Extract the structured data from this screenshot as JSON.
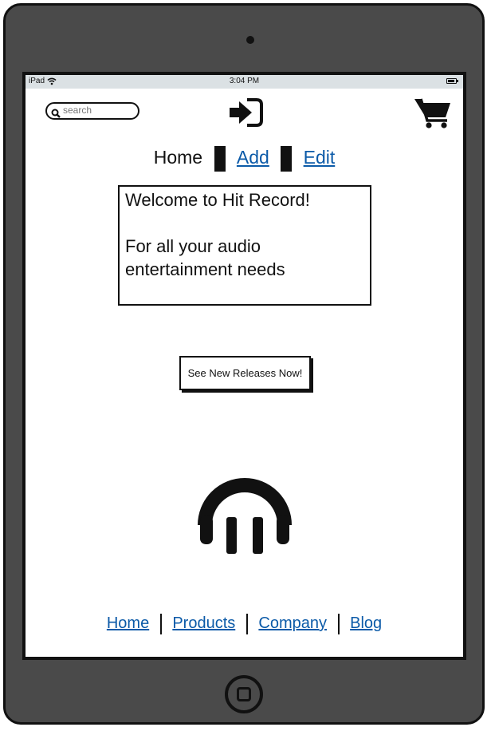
{
  "status_bar": {
    "carrier": "iPad",
    "time": "3:04 PM"
  },
  "header": {
    "search_placeholder": "search",
    "icons": [
      "search-icon",
      "login-icon",
      "cart-icon"
    ]
  },
  "top_nav": {
    "current": "Home",
    "links": [
      "Add",
      "Edit"
    ]
  },
  "welcome": {
    "line1": "Welcome to Hit Record!",
    "line2": "For all your audio",
    "line3": "entertainment needs"
  },
  "cta": {
    "label": "See New Releases Now!"
  },
  "hero_icon": "headphones-icon",
  "footer_nav": {
    "links": [
      "Home",
      "Products",
      "Company",
      "Blog"
    ]
  },
  "colors": {
    "link": "#0b5aa8",
    "device": "#4a4a4a",
    "status_bar": "#dbe1e4"
  }
}
